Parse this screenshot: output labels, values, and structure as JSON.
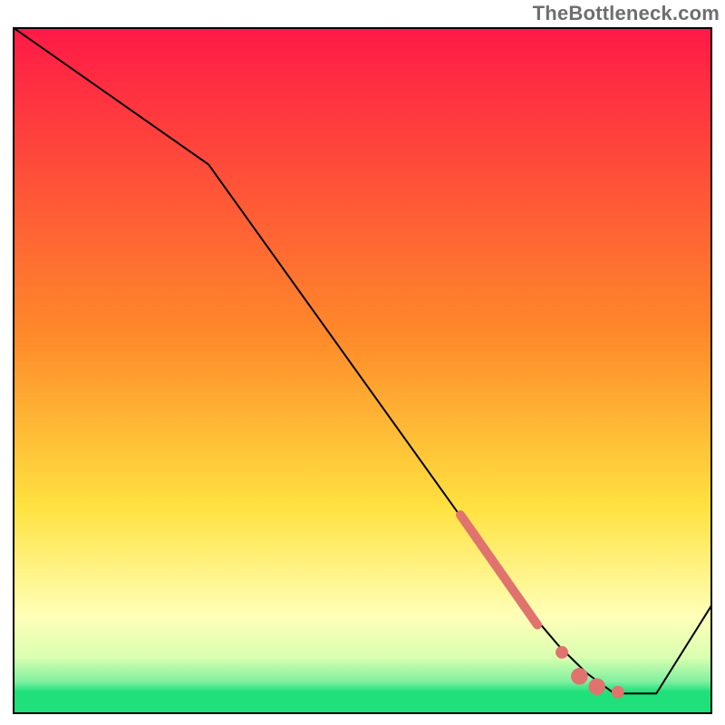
{
  "watermark": "TheBottleneck.com",
  "colors": {
    "border": "#000000",
    "line": "#000000",
    "marker": "#e0736d",
    "gradient_top": "#ff1a47",
    "gradient_mid1": "#ff8a2a",
    "gradient_mid2": "#ffe240",
    "gradient_pale": "#ffffb8",
    "gradient_green": "#1fe07a"
  },
  "chart_data": {
    "type": "line",
    "title": "",
    "xlabel": "",
    "ylabel": "",
    "xlim": [
      0,
      100
    ],
    "ylim": [
      0,
      100
    ],
    "series": [
      {
        "name": "curve",
        "x": [
          0,
          28,
          73,
          78,
          82,
          86,
          92,
          100
        ],
        "y": [
          100,
          80,
          16,
          10,
          6,
          3,
          3,
          16
        ]
      }
    ],
    "markers": [
      {
        "name": "thick-segment",
        "kind": "segment",
        "x": [
          64,
          75
        ],
        "y": [
          29,
          13
        ],
        "width_pct": 1.3
      },
      {
        "name": "dot-a",
        "kind": "dot",
        "x": 78.5,
        "y": 9,
        "r_pct": 0.9
      },
      {
        "name": "dot-b",
        "kind": "dot",
        "x": 81,
        "y": 5.5,
        "r_pct": 1.2
      },
      {
        "name": "dot-c",
        "kind": "dot",
        "x": 83.5,
        "y": 4,
        "r_pct": 1.2
      },
      {
        "name": "dot-d",
        "kind": "dot",
        "x": 86.5,
        "y": 3.2,
        "r_pct": 0.9
      }
    ],
    "background_gradient_stops": [
      {
        "offset": 0.0,
        "color": "#ff1a47"
      },
      {
        "offset": 0.45,
        "color": "#ff8a2a"
      },
      {
        "offset": 0.7,
        "color": "#ffe240"
      },
      {
        "offset": 0.86,
        "color": "#ffffb8"
      },
      {
        "offset": 0.92,
        "color": "#d9ffb0"
      },
      {
        "offset": 0.955,
        "color": "#7ff0a0"
      },
      {
        "offset": 0.97,
        "color": "#1fe07a"
      },
      {
        "offset": 1.0,
        "color": "#1fe07a"
      }
    ]
  }
}
